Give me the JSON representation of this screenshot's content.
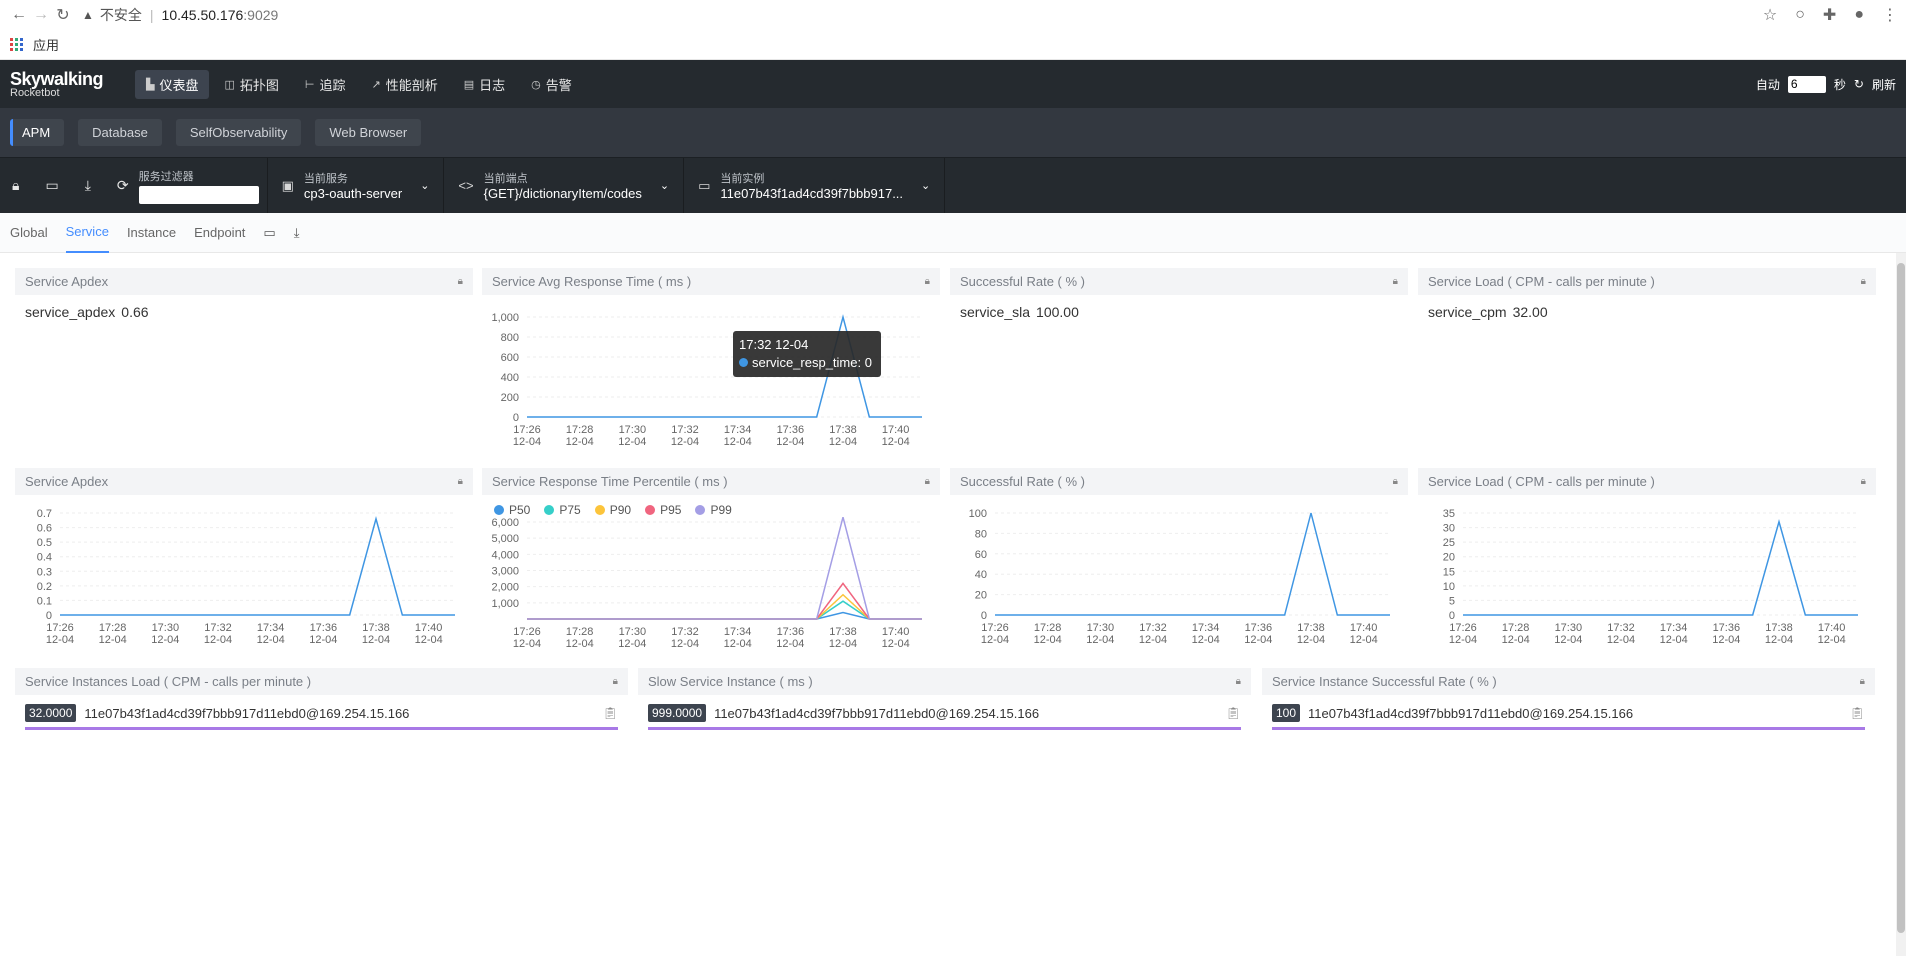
{
  "browser": {
    "insecure_label": "不安全",
    "url_host": "10.45.50.176",
    "url_port": ":9029",
    "bookmark_apps": "应用"
  },
  "topnav": {
    "logo_line1": "Skywalking",
    "logo_line2": "Rocketbot",
    "menu": [
      {
        "label": "仪表盘",
        "icon": "dashboard-icon"
      },
      {
        "label": "拓扑图",
        "icon": "topology-icon"
      },
      {
        "label": "追踪",
        "icon": "trace-icon"
      },
      {
        "label": "性能剖析",
        "icon": "profile-icon"
      },
      {
        "label": "日志",
        "icon": "log-icon"
      },
      {
        "label": "告警",
        "icon": "alarm-icon"
      }
    ],
    "auto_label": "自动",
    "interval_value": "6",
    "seconds_label": "秒",
    "refresh_label": "刷新"
  },
  "subnav": {
    "tabs": [
      "APM",
      "Database",
      "SelfObservability",
      "Web Browser"
    ]
  },
  "toolbar": {
    "filter_label": "服务过滤器",
    "filter_value": "",
    "service_label": "当前服务",
    "service_value": "cp3-oauth-server",
    "endpoint_label": "当前端点",
    "endpoint_value": "{GET}/dictionaryItem/codes",
    "instance_label": "当前实例",
    "instance_value": "11e07b43f1ad4cd39f7bbb917..."
  },
  "tabs": [
    "Global",
    "Service",
    "Instance",
    "Endpoint"
  ],
  "row1": {
    "apdex": {
      "title": "Service Apdex",
      "metric": "service_apdex",
      "value": "0.66"
    },
    "avg_resp": {
      "title": "Service Avg Response Time ( ms )"
    },
    "sla": {
      "title": "Successful Rate ( % )",
      "metric": "service_sla",
      "value": "100.00"
    },
    "cpm": {
      "title": "Service Load ( CPM - calls per minute )",
      "metric": "service_cpm",
      "value": "32.00"
    }
  },
  "tooltip": {
    "time": "17:32 12-04",
    "series": "service_resp_time: 0"
  },
  "row2": {
    "apdex_title": "Service Apdex",
    "percentile_title": "Service Response Time Percentile ( ms )",
    "sla_title": "Successful Rate ( % )",
    "cpm_title": "Service Load ( CPM - calls per minute )"
  },
  "row3": [
    {
      "title": "Service Instances Load ( CPM - calls per minute )",
      "badge": "32.0000",
      "name": "11e07b43f1ad4cd39f7bbb917d11ebd0@169.254.15.166",
      "fill": 1.0
    },
    {
      "title": "Slow Service Instance ( ms )",
      "badge": "999.0000",
      "name": "11e07b43f1ad4cd39f7bbb917d11ebd0@169.254.15.166",
      "fill": 1.0
    },
    {
      "title": "Service Instance Successful Rate ( % )",
      "badge": "100",
      "name": "11e07b43f1ad4cd39f7bbb917d11ebd0@169.254.15.166",
      "fill": 1.0
    }
  ],
  "colors": {
    "accent": "#448dfe",
    "line": "#3f96e3",
    "p50": "#3f96e3",
    "p75": "#36cfc9",
    "p90": "#fcc43b",
    "p95": "#f0657f",
    "p99": "#a49ee5",
    "bar": "#a879e6"
  },
  "chart_data": [
    {
      "type": "line",
      "title": "Service Avg Response Time ( ms )",
      "x": [
        "17:26\n12-04",
        "17:27",
        "17:28\n12-04",
        "17:29",
        "17:30\n12-04",
        "17:31",
        "17:32\n12-04",
        "17:33",
        "17:34\n12-04",
        "17:35",
        "17:36\n12-04",
        "17:37",
        "17:38\n12-04",
        "17:39",
        "17:40\n12-04",
        "17:41"
      ],
      "xticks": [
        "17:26",
        "17:28",
        "17:30",
        "17:32",
        "17:34",
        "17:36",
        "17:38",
        "17:40"
      ],
      "xdate": "12-04",
      "series": [
        {
          "name": "service_resp_time",
          "values": [
            0,
            0,
            0,
            0,
            0,
            0,
            0,
            0,
            0,
            0,
            0,
            0,
            999,
            0,
            0,
            0
          ]
        }
      ],
      "yticks": [
        "0",
        "200",
        "400",
        "600",
        "800",
        "1,000"
      ],
      "ylim": [
        0,
        1000
      ]
    },
    {
      "type": "line",
      "title": "Service Apdex",
      "xticks": [
        "17:26",
        "17:28",
        "17:30",
        "17:32",
        "17:34",
        "17:36",
        "17:38",
        "17:40"
      ],
      "xdate": "12-04",
      "series": [
        {
          "name": "service_apdex",
          "values": [
            0,
            0,
            0,
            0,
            0,
            0,
            0,
            0,
            0,
            0,
            0,
            0,
            0.66,
            0,
            0,
            0
          ]
        }
      ],
      "yticks": [
        "0",
        "0.1",
        "0.2",
        "0.3",
        "0.4",
        "0.5",
        "0.6",
        "0.7"
      ],
      "ylim": [
        0,
        0.7
      ]
    },
    {
      "type": "line",
      "title": "Service Response Time Percentile ( ms )",
      "xticks": [
        "17:26",
        "17:28",
        "17:30",
        "17:32",
        "17:34",
        "17:36",
        "17:38",
        "17:40"
      ],
      "xdate": "12-04",
      "series": [
        {
          "name": "P50",
          "values": [
            0,
            0,
            0,
            0,
            0,
            0,
            0,
            0,
            0,
            0,
            0,
            0,
            400,
            0,
            0,
            0
          ]
        },
        {
          "name": "P75",
          "values": [
            0,
            0,
            0,
            0,
            0,
            0,
            0,
            0,
            0,
            0,
            0,
            0,
            1100,
            0,
            0,
            0
          ]
        },
        {
          "name": "P90",
          "values": [
            0,
            0,
            0,
            0,
            0,
            0,
            0,
            0,
            0,
            0,
            0,
            0,
            1500,
            0,
            0,
            0
          ]
        },
        {
          "name": "P95",
          "values": [
            0,
            0,
            0,
            0,
            0,
            0,
            0,
            0,
            0,
            0,
            0,
            0,
            2200,
            0,
            0,
            0
          ]
        },
        {
          "name": "P99",
          "values": [
            0,
            0,
            0,
            0,
            0,
            0,
            0,
            0,
            0,
            0,
            0,
            0,
            6300,
            0,
            0,
            0
          ]
        }
      ],
      "yticks": [
        "1,000",
        "2,000",
        "3,000",
        "4,000",
        "5,000",
        "6,000"
      ],
      "ylim": [
        0,
        6000
      ]
    },
    {
      "type": "line",
      "title": "Successful Rate ( % )",
      "xticks": [
        "17:26",
        "17:28",
        "17:30",
        "17:32",
        "17:34",
        "17:36",
        "17:38",
        "17:40"
      ],
      "xdate": "12-04",
      "series": [
        {
          "name": "service_sla",
          "values": [
            0,
            0,
            0,
            0,
            0,
            0,
            0,
            0,
            0,
            0,
            0,
            0,
            100,
            0,
            0,
            0
          ]
        }
      ],
      "yticks": [
        "0",
        "20",
        "40",
        "60",
        "80",
        "100"
      ],
      "ylim": [
        0,
        100
      ]
    },
    {
      "type": "line",
      "title": "Service Load ( CPM - calls per minute )",
      "xticks": [
        "17:26",
        "17:28",
        "17:30",
        "17:32",
        "17:34",
        "17:36",
        "17:38",
        "17:40"
      ],
      "xdate": "12-04",
      "series": [
        {
          "name": "service_cpm",
          "values": [
            0,
            0,
            0,
            0,
            0,
            0,
            0,
            0,
            0,
            0,
            0,
            0,
            32,
            0,
            0,
            0
          ]
        }
      ],
      "yticks": [
        "0",
        "5",
        "10",
        "15",
        "20",
        "25",
        "30",
        "35"
      ],
      "ylim": [
        0,
        35
      ]
    }
  ]
}
